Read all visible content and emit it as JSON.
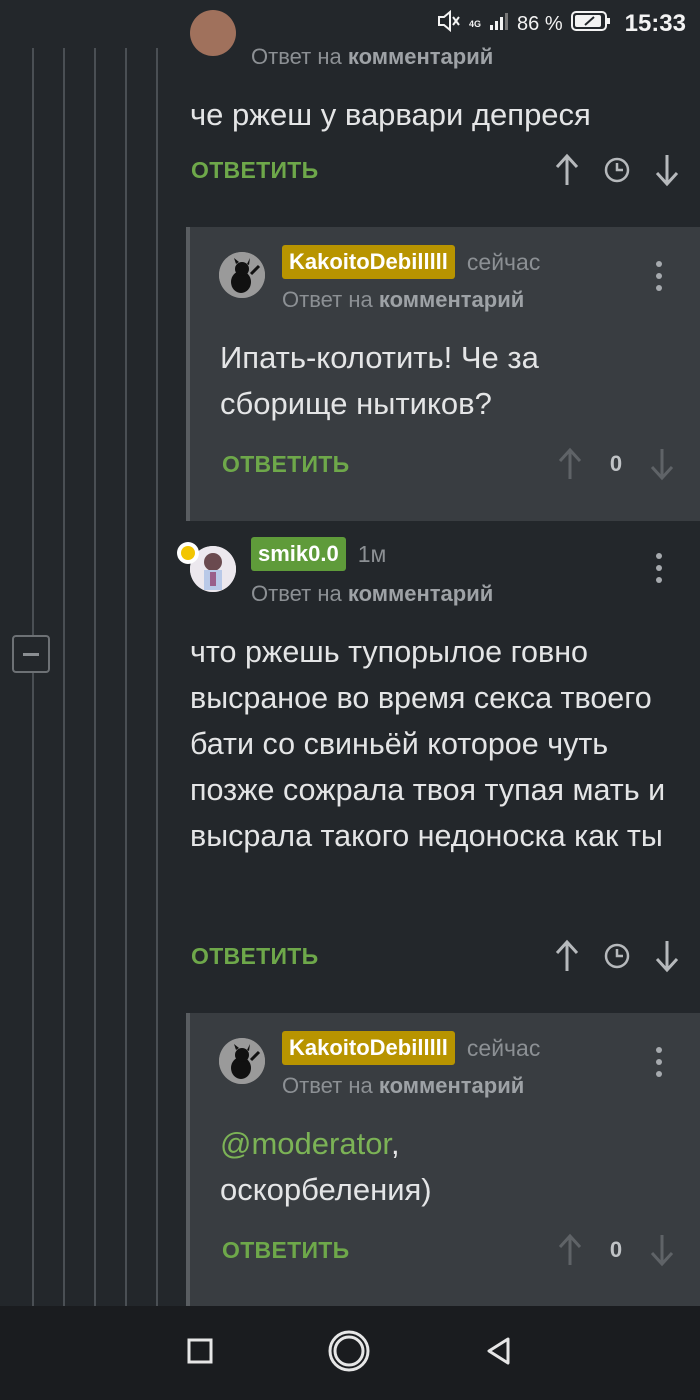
{
  "status_bar": {
    "network": "4G",
    "battery": "86 %",
    "time": "15:33"
  },
  "comments": [
    {
      "reply_prefix": "Ответ на",
      "reply_target": "комментарий",
      "text": "че ржеш у варвари депреся",
      "answer_label": "ОТВЕТИТЬ"
    },
    {
      "username": "KakoitoDebilllll",
      "time": "сейчас",
      "reply_prefix": "Ответ на",
      "reply_target": "комментарий",
      "text": "Ипать-колотить! Че за сборище нытиков?",
      "answer_label": "ОТВЕТИТЬ",
      "rating": "0"
    },
    {
      "username": "smik0.0",
      "time": "1м",
      "reply_prefix": "Ответ на",
      "reply_target": "комментарий",
      "text": "что ржешь тупорылое говно высраное во время секса твоего бати со свиньёй которое чуть позже сожрала твоя тупая мать и высрала такого недоноска как ты",
      "answer_label": "ОТВЕТИТЬ"
    },
    {
      "username": "KakoitoDebilllll",
      "time": "сейчас",
      "reply_prefix": "Ответ на",
      "reply_target": "комментарий",
      "mention": "@moderator",
      "text_after_mention": ",",
      "text_line2": "оскорбеления)",
      "answer_label": "ОТВЕТИТЬ",
      "rating": "0"
    }
  ],
  "icons": {
    "up": "arrow-up-icon",
    "clock": "clock-icon",
    "down": "arrow-down-icon",
    "more": "more-vert-icon",
    "collapse": "minus-icon"
  },
  "colors": {
    "accent_green": "#6ea84a",
    "badge_gold": "#b89400",
    "badge_green": "#5f9b3a",
    "background": "#23272b",
    "reply_background": "#393d41"
  }
}
